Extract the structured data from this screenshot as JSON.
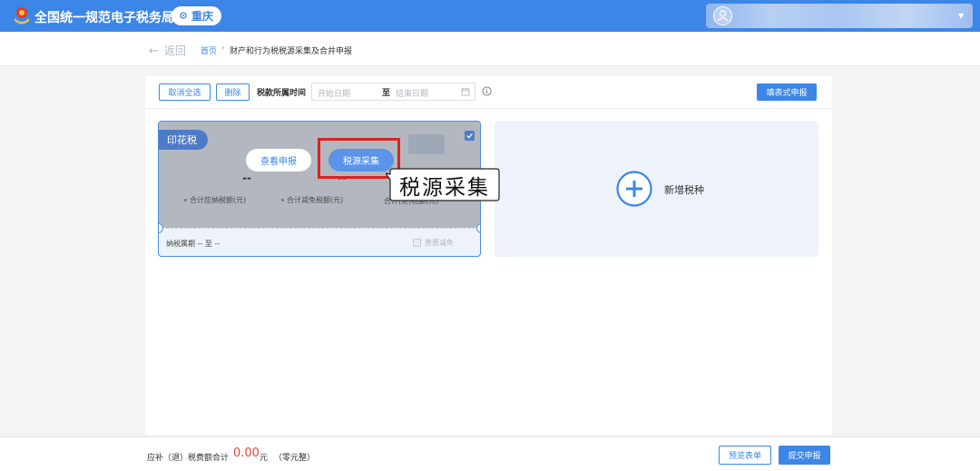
{
  "header": {
    "site_title": "全国统一规范电子税务局",
    "city": "重庆",
    "brand_color": "#3c86e8"
  },
  "breadcrumb": {
    "back_label": "返回",
    "home": "首页",
    "separator": "›",
    "current": "财产和行为税税源采集及合并申报"
  },
  "toolbar": {
    "cancel_all": "取消全选",
    "delete": "删除",
    "period_label": "税款所属时间",
    "start_placeholder": "开始日期",
    "to": "至",
    "end_placeholder": "结束日期",
    "fill_form_declare": "填表式申报"
  },
  "tax_card": {
    "name": "印花税",
    "selected": true,
    "view_declare": "查看申报",
    "collect_source": "税源采集",
    "payable_value": "--",
    "payable_label": "合计应纳税额(元)",
    "relief_value": "--",
    "relief_label": "合计减免税额(元)",
    "right_label": "合计(退)税额(元)",
    "period_text": "纳税属期 -- 至 --",
    "relief_checkbox": "普惠减免"
  },
  "add_card": {
    "label": "新增税种"
  },
  "annotation": {
    "callout": "税源采集",
    "highlight_color": "#e02020"
  },
  "footer": {
    "total_label": "应补（退）税费额合计",
    "total_value": "0.00",
    "unit": "元",
    "total_cn": "（零元整）",
    "preview": "预览表单",
    "submit": "提交申报"
  }
}
